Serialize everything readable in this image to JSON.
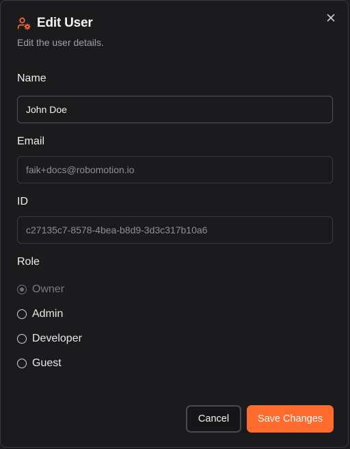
{
  "dialog": {
    "title": "Edit User",
    "subtitle": "Edit the user details.",
    "accent_color": "#ff6b2c",
    "header_icon": "user-gear-icon",
    "close_icon": "close-icon"
  },
  "form": {
    "name": {
      "label": "Name",
      "value": "John Doe"
    },
    "email": {
      "label": "Email",
      "value": "faik+docs@robomotion.io"
    },
    "id": {
      "label": "ID",
      "value": "c27135c7-8578-4bea-b8d9-3d3c317b10a6"
    },
    "role": {
      "label": "Role",
      "selected": "Owner",
      "options": [
        {
          "label": "Owner",
          "checked": true,
          "disabled": true
        },
        {
          "label": "Admin",
          "checked": false,
          "disabled": false
        },
        {
          "label": "Developer",
          "checked": false,
          "disabled": false
        },
        {
          "label": "Guest",
          "checked": false,
          "disabled": false
        }
      ]
    }
  },
  "actions": {
    "cancel_label": "Cancel",
    "save_label": "Save Changes"
  }
}
